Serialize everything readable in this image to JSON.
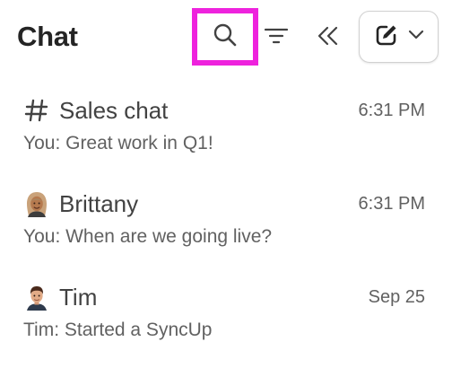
{
  "header": {
    "title": "Chat",
    "icons": {
      "search": "search-icon",
      "filter": "filter-icon",
      "collapse": "double-chevron-left-icon",
      "compose": "compose-icon",
      "dropdown": "chevron-down-icon"
    }
  },
  "colors": {
    "highlight": "#ee22dd",
    "title": "#242424",
    "name": "#424242",
    "secondary": "#616161"
  },
  "chats": [
    {
      "name": "Sales chat",
      "time": "6:31 PM",
      "preview": "You: Great work in Q1!",
      "avatar": "hashtag-icon"
    },
    {
      "name": "Brittany",
      "time": "6:31 PM",
      "preview": "You: When are we going live?",
      "avatar": "user-avatar"
    },
    {
      "name": "Tim",
      "time": "Sep 25",
      "preview": "Tim: Started a SyncUp",
      "avatar": "user-avatar"
    }
  ]
}
